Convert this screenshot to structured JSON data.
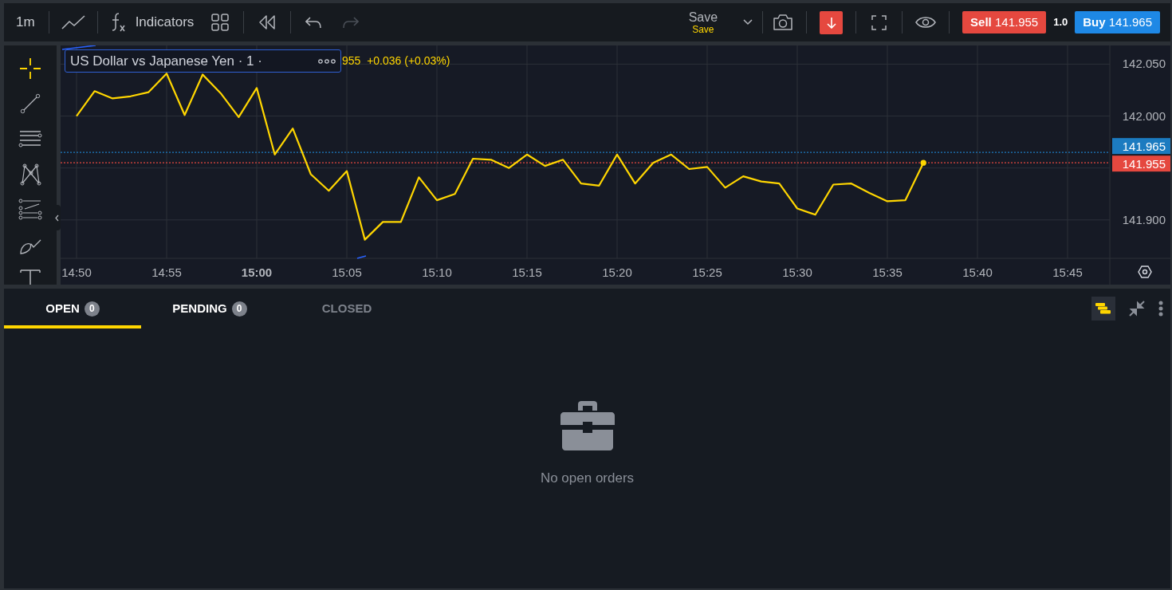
{
  "toolbar": {
    "interval": "1m",
    "indicators_label": "Indicators",
    "undo": {
      "disabled": false
    },
    "redo": {
      "disabled": true
    },
    "save": {
      "label": "Save",
      "sublabel": "Save"
    },
    "sell": {
      "label": "Sell",
      "price": "141.955"
    },
    "quantity": "1.0",
    "buy": {
      "label": "Buy",
      "price": "141.965"
    }
  },
  "drawing_tools": [
    {
      "kind": "crosshair",
      "selected": true
    },
    {
      "kind": "trendline",
      "selected": false
    },
    {
      "kind": "channel",
      "selected": false
    },
    {
      "kind": "pattern",
      "selected": false
    },
    {
      "kind": "fib",
      "selected": false
    },
    {
      "kind": "brush",
      "selected": false
    },
    {
      "kind": "text",
      "selected": false
    }
  ],
  "chart": {
    "legend": {
      "symbol": "US Dollar vs Japanese Yen · 1 ·",
      "values": "955  +0.036 (+0.03%)"
    },
    "chart_data": {
      "type": "line",
      "categories": [
        "14:50",
        null,
        null,
        null,
        null,
        "14:55",
        null,
        null,
        null,
        null,
        "15:00",
        null,
        null,
        null,
        null,
        "15:05",
        null,
        null,
        null,
        null,
        "15:10",
        null,
        null,
        null,
        null,
        "15:15",
        null,
        null,
        null,
        null,
        "15:20",
        null,
        null,
        null,
        null,
        "15:25",
        null,
        null,
        null,
        null,
        "15:30",
        null,
        null,
        null,
        null,
        "15:35",
        null,
        null,
        null,
        null,
        "15:40",
        null,
        null,
        null,
        null,
        "15:45",
        null,
        null
      ],
      "series": [
        {
          "color": "#ffd600",
          "values": [
            142.0,
            142.024,
            142.017,
            142.019,
            142.023,
            142.041,
            142.001,
            142.04,
            142.022,
            141.999,
            142.027,
            141.963,
            141.988,
            141.944,
            141.928,
            141.947,
            141.881,
            141.898,
            141.898,
            141.941,
            141.919,
            141.925,
            141.959,
            141.958,
            141.95,
            141.963,
            141.952,
            141.958,
            141.935,
            141.933,
            141.963,
            141.935,
            141.955,
            141.963,
            141.949,
            141.951,
            141.931,
            141.942,
            141.937,
            141.935,
            141.911,
            141.905,
            141.934,
            141.935,
            141.926,
            141.918,
            141.919,
            141.955,
            null,
            null,
            null,
            null,
            null,
            null,
            null,
            null,
            null,
            null
          ]
        }
      ],
      "ylim": [
        141.863,
        142.068
      ],
      "grid": true,
      "ref_lines": [
        {
          "axis": "y",
          "value": 141.965,
          "label": "141.965",
          "color": "#1c7bc0"
        },
        {
          "axis": "y",
          "value": 141.955,
          "label": "141.955",
          "color": "#e5483f"
        }
      ],
      "yticks": [
        {
          "value": 141.9,
          "label": "141.900"
        },
        {
          "value": 142.0,
          "label": "142.000"
        },
        {
          "value": 142.05,
          "label": "142.050"
        }
      ]
    }
  },
  "orders": {
    "tabs": [
      {
        "label": "OPEN",
        "count": "0",
        "selected": true,
        "disabled": false
      },
      {
        "label": "PENDING",
        "count": "0",
        "selected": false,
        "disabled": false
      },
      {
        "label": "CLOSED",
        "selected": false,
        "disabled": true
      }
    ],
    "empty_message": "No open orders"
  }
}
